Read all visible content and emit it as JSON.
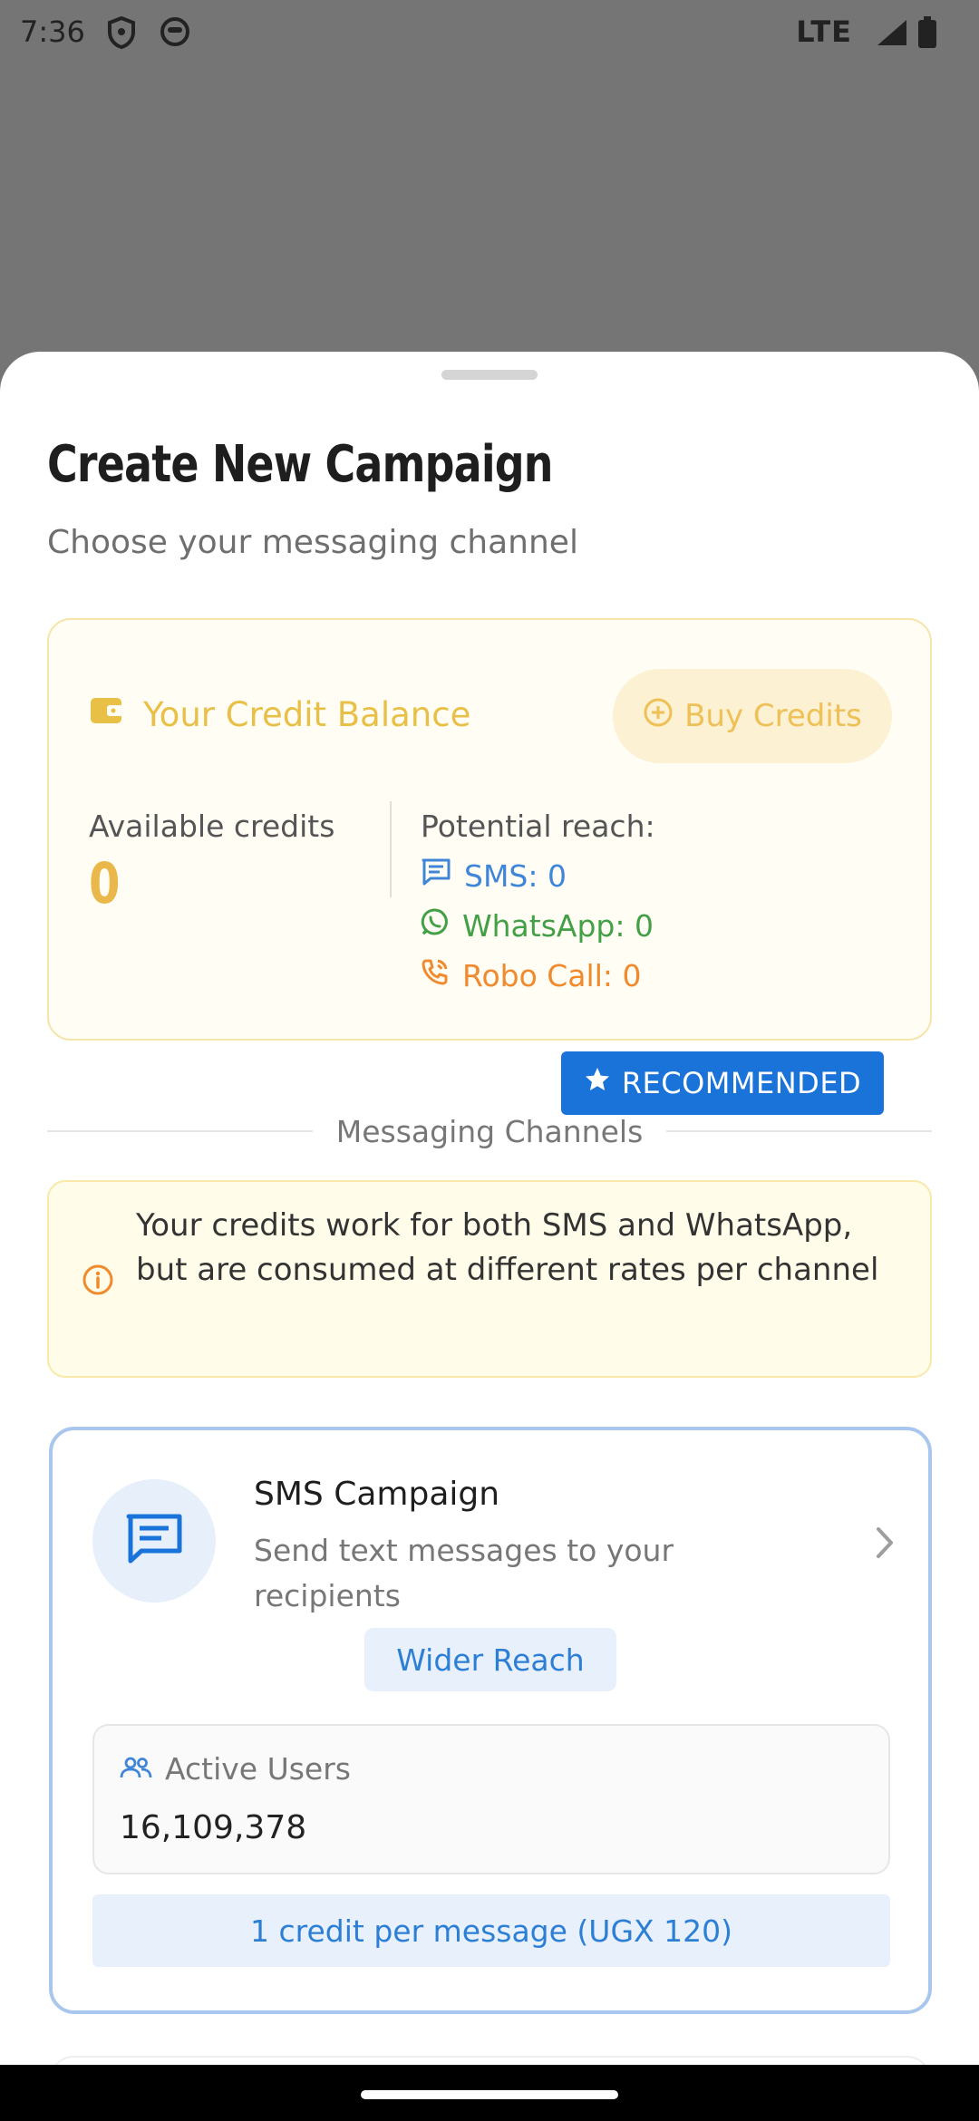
{
  "status_bar": {
    "time": "7:36",
    "network": "LTE"
  },
  "sheet": {
    "title": "Create New Campaign",
    "subtitle": "Choose your messaging channel"
  },
  "credit_card": {
    "title": "Your Credit Balance",
    "buy_label": "Buy Credits",
    "available_label": "Available credits",
    "available_value": "0",
    "reach_label": "Potential reach:",
    "reach_sms": "SMS: 0",
    "reach_whatsapp": "WhatsApp: 0",
    "reach_robo": "Robo Call: 0"
  },
  "section": {
    "label": "Messaging Channels"
  },
  "notice": {
    "text": "Your credits work for both SMS and WhatsApp, but are consumed at different rates per channel"
  },
  "sms_card": {
    "badge": "RECOMMENDED",
    "title": "SMS Campaign",
    "description": "Send text messages to your recipients",
    "tag": "Wider Reach",
    "users_label": "Active Users",
    "users_value": "16,109,378",
    "rate": "1 credit per message (UGX 120)"
  },
  "colors": {
    "accent_blue": "#1a73d9",
    "credit_gold": "#e9c047",
    "whatsapp_green": "#43a047",
    "robo_orange": "#f08a2c"
  }
}
